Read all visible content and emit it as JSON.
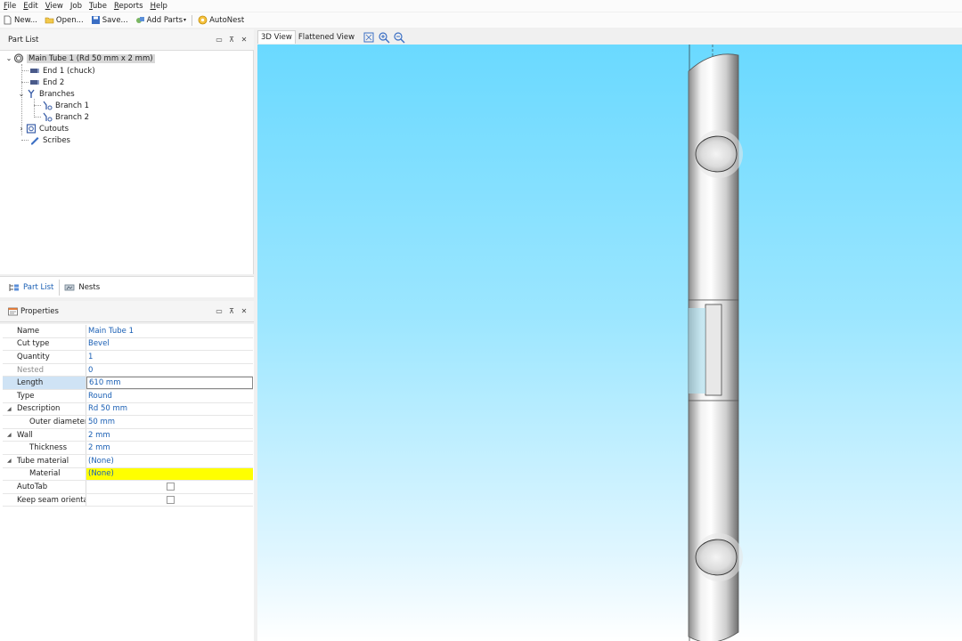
{
  "menu": {
    "items": [
      {
        "first": "F",
        "rest": "ile"
      },
      {
        "first": "E",
        "rest": "dit"
      },
      {
        "first": "V",
        "rest": "iew"
      },
      {
        "first": "J",
        "rest": "ob"
      },
      {
        "first": "T",
        "rest": "ube"
      },
      {
        "first": "R",
        "rest": "eports"
      },
      {
        "first": "H",
        "rest": "elp"
      }
    ]
  },
  "toolbar": {
    "new_label": "New...",
    "open_label": "Open...",
    "save_label": "Save...",
    "add_parts_label": "Add Parts",
    "autonest_label": "AutoNest"
  },
  "part_list": {
    "title": "Part List",
    "tree": {
      "root": "Main Tube 1 (Rd 50 mm x 2 mm)",
      "end1": "End 1 (chuck)",
      "end2": "End 2",
      "branches": "Branches",
      "branch1": "Branch 1",
      "branch2": "Branch 2",
      "cutouts": "Cutouts",
      "scribes": "Scribes"
    },
    "tabs": {
      "part_list": "Part List",
      "nests": "Nests"
    }
  },
  "properties": {
    "title": "Properties",
    "rows": [
      {
        "name": "Name",
        "value": "Main Tube 1"
      },
      {
        "name": "Cut type",
        "value": "Bevel"
      },
      {
        "name": "Quantity",
        "value": "1"
      },
      {
        "name": "Nested",
        "value": "0"
      },
      {
        "name": "Length",
        "value": "610 mm"
      },
      {
        "name": "Type",
        "value": "Round"
      },
      {
        "name": "Description",
        "value": "Rd 50 mm"
      },
      {
        "name": "Outer diameter",
        "value": "50 mm"
      },
      {
        "name": "Wall",
        "value": "2 mm"
      },
      {
        "name": "Thickness",
        "value": "2 mm"
      },
      {
        "name": "Tube material",
        "value": "(None)"
      },
      {
        "name": "Material",
        "value": "(None)"
      },
      {
        "name": "AutoTab",
        "value": ""
      },
      {
        "name": "Keep seam orientati",
        "value": ""
      }
    ]
  },
  "view": {
    "tab_3d": "3D View",
    "tab_flat": "Flattened View"
  },
  "colors": {
    "accent": "#1a5fb4",
    "highlight_yellow": "#ffff00",
    "viewport_top": "#6ad9ff",
    "viewport_bottom": "#ffffff"
  }
}
